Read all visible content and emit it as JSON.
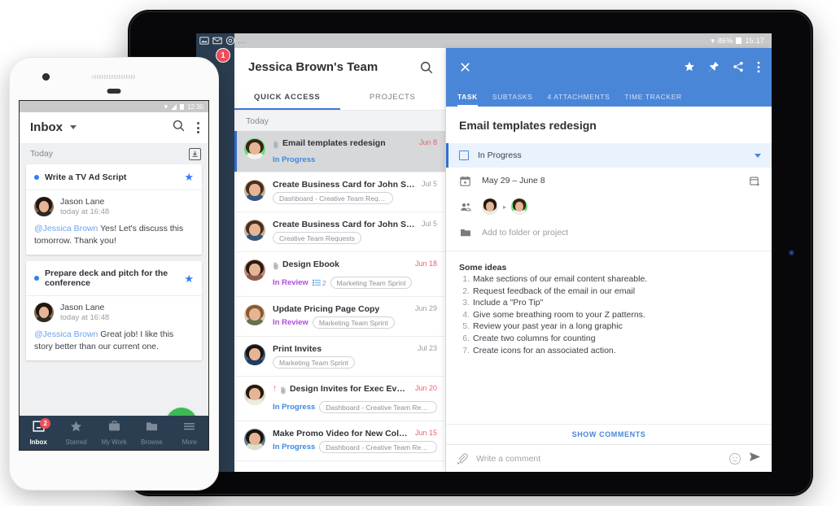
{
  "tablet": {
    "statusbar": {
      "wifi_icon": "wifi-icon",
      "battery_percent": "86%",
      "time": "15:17"
    },
    "rail": {
      "icons": [
        "image-icon",
        "envelope-icon",
        "at-circle-icon"
      ],
      "overflow": "...",
      "badge": "1"
    },
    "list": {
      "title": "Jessica Brown's Team",
      "search_icon": "search-icon",
      "tabs": [
        {
          "label": "QUICK ACCESS",
          "active": true
        },
        {
          "label": "PROJECTS",
          "active": false
        }
      ],
      "section_header": "Today",
      "rows": [
        {
          "name": "Email templates redesign",
          "date": "Jun 8",
          "date_due": true,
          "status": "In Progress",
          "status_kind": "progress",
          "tag": "",
          "attachment": true,
          "flag": false,
          "subtasks": "",
          "selected": true,
          "avatar": {
            "bg": "#6ddb7a",
            "hair": "#3a2317",
            "body": "#f2f1ee"
          }
        },
        {
          "name": "Create Business Card for John Smith",
          "date": "Jul 5",
          "date_due": false,
          "status": "",
          "status_kind": "",
          "tag": "Dashboard - Creative Team Requests",
          "attachment": false,
          "flag": false,
          "subtasks": "",
          "selected": false,
          "avatar": {
            "bg": "#c3b49a",
            "hair": "#4a2e1c",
            "body": "#33557e"
          }
        },
        {
          "name": "Create Business Card for John Smith",
          "date": "Jul 5",
          "date_due": false,
          "status": "",
          "status_kind": "",
          "tag": "Creative Team Requests",
          "attachment": false,
          "flag": false,
          "subtasks": "",
          "selected": false,
          "avatar": {
            "bg": "#c3b49a",
            "hair": "#4a2e1c",
            "body": "#33557e"
          }
        },
        {
          "name": "Design Ebook",
          "date": "Jun 18",
          "date_due": true,
          "status": "In Review",
          "status_kind": "review",
          "tag": "Marketing Team Sprint",
          "attachment": true,
          "flag": false,
          "subtasks": "2",
          "selected": false,
          "avatar": {
            "bg": "#b98b79",
            "hair": "#2a1a12",
            "body": "#8d5d4c"
          }
        },
        {
          "name": "Update Pricing Page Copy",
          "date": "Jun 29",
          "date_due": false,
          "status": "In Review",
          "status_kind": "review",
          "tag": "Marketing Team Sprint",
          "attachment": false,
          "flag": false,
          "subtasks": "",
          "selected": false,
          "avatar": {
            "bg": "#d8cdb6",
            "hair": "#8a5a2e",
            "body": "#6a6f52"
          }
        },
        {
          "name": "Print Invites",
          "date": "Jul 23",
          "date_due": false,
          "status": "",
          "status_kind": "",
          "tag": "Marketing Team Sprint",
          "attachment": false,
          "flag": false,
          "subtasks": "",
          "selected": false,
          "avatar": {
            "bg": "#3d5a80",
            "hair": "#1d120c",
            "body": "#223c5c"
          }
        },
        {
          "name": "Design Invites for Exec Event",
          "date": "Jun 20",
          "date_due": true,
          "status": "In Progress",
          "status_kind": "progress",
          "tag": "Dashboard - Creative Team Requ...",
          "attachment": true,
          "flag": true,
          "subtasks": "",
          "selected": false,
          "avatar": {
            "bg": "#ded6c8",
            "hair": "#241812",
            "body": "#efeae2"
          }
        },
        {
          "name": "Make Promo Video for New Collection",
          "date": "Jun 15",
          "date_due": true,
          "status": "In Progress",
          "status_kind": "progress",
          "tag": "Dashboard - Creative Team Requ...",
          "attachment": false,
          "flag": false,
          "subtasks": "",
          "selected": false,
          "avatar": {
            "bg": "#5f7c93",
            "hair": "#1c1410",
            "body": "#d9e2c8"
          }
        }
      ]
    },
    "detail": {
      "close_icon": "close-icon",
      "star_icon": "star-icon",
      "pin_icon": "pin-icon",
      "share_icon": "share-icon",
      "more_icon": "more-vertical-icon",
      "tabs": [
        {
          "label": "TASK",
          "active": true
        },
        {
          "label": "SUBTASKS",
          "active": false
        },
        {
          "label": "4 ATTACHMENTS",
          "active": false
        },
        {
          "label": "TIME TRACKER",
          "active": false
        }
      ],
      "title": "Email templates redesign",
      "status": "In Progress",
      "status_caret_icon": "chevron-down-icon",
      "date_icon": "calendar-icon",
      "date_range": "May 29 – June 8",
      "add_date_icon": "calendar-add-icon",
      "assignee_icon": "people-icon",
      "assignee_arrow": "▸",
      "assignees": [
        {
          "bg": "#e8e4dc",
          "hair": "#241812",
          "body": "#efeae2"
        },
        {
          "bg": "#6ddb7a",
          "hair": "#3a2317",
          "body": "#f2f1ee"
        }
      ],
      "folder_icon": "folder-icon",
      "folder_placeholder": "Add to folder or project",
      "notes_title": "Some ideas",
      "notes": [
        "Make sections of our email content shareable.",
        "Request feedback of the email in our email",
        "Include a \"Pro Tip\"",
        "Give some breathing room to your Z patterns.",
        "Review your past year in a long graphic",
        "Create two columns for counting",
        "Create icons for an associated action."
      ],
      "show_comments": "SHOW COMMENTS",
      "attach_icon": "attachment-add-icon",
      "comment_placeholder": "Write a comment",
      "emoji_icon": "emoji-icon",
      "send_icon": "send-icon"
    }
  },
  "phone": {
    "statusbar": {
      "icons": [
        "wifi-icon",
        "signal-icon",
        "battery-icon"
      ],
      "time": "12:30"
    },
    "appbar": {
      "title": "Inbox",
      "caret_icon": "chevron-down-icon",
      "search_icon": "search-icon",
      "menu_icon": "more-vertical-icon"
    },
    "section_header": "Today",
    "archive_icon": "archive-download-icon",
    "cards": [
      {
        "title": "Write a TV Ad Script",
        "starred": true,
        "author": "Jason Lane",
        "time": "today at 16:48",
        "mention": "@Jessica Brown",
        "text": " Yes! Let's discuss this tomorrow. Thank you!",
        "avatar": {
          "bg": "#8a6b4f",
          "hair": "#221711",
          "body": "#2e2a27"
        }
      },
      {
        "title": "Prepare deck and pitch for the conference",
        "starred": true,
        "author": "Jason Lane",
        "time": "today at 16:48",
        "mention": "@Jessica Brown",
        "text": " Great job! I like this story better than our current one.",
        "avatar": {
          "bg": "#8a6b4f",
          "hair": "#221711",
          "body": "#2e2a27"
        }
      }
    ],
    "fab": {
      "icon": "plus-icon",
      "label": "+"
    },
    "bottom_nav": [
      {
        "label": "Inbox",
        "icon": "inbox-icon",
        "active": true,
        "badge": "2"
      },
      {
        "label": "Starred",
        "icon": "star-icon",
        "active": false,
        "badge": ""
      },
      {
        "label": "My Work",
        "icon": "briefcase-icon",
        "active": false,
        "badge": ""
      },
      {
        "label": "Browse",
        "icon": "folder-icon",
        "active": false,
        "badge": ""
      },
      {
        "label": "More",
        "icon": "hamburger-icon",
        "active": false,
        "badge": ""
      }
    ]
  },
  "colors": {
    "accent_blue": "#4a86d8",
    "nav_dark": "#2b3e51",
    "status_progress": "#3b87e8",
    "status_review": "#b24bd8",
    "due_red": "#ef5e6e",
    "badge_red": "#ef4e5a",
    "fab_green": "#3cba54"
  }
}
